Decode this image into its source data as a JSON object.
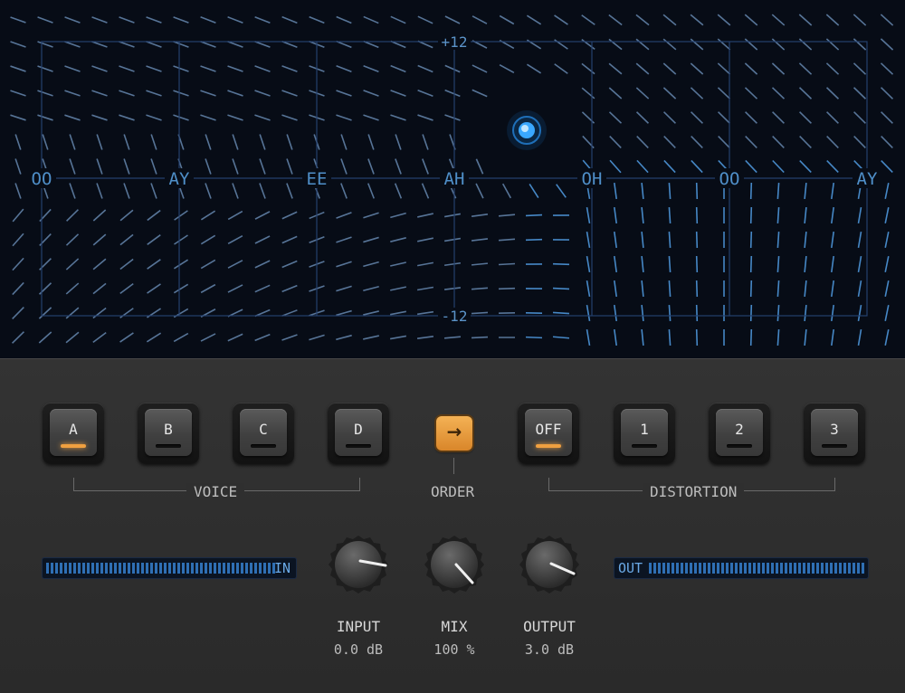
{
  "display": {
    "vowels": [
      "OO",
      "AY",
      "EE",
      "AH",
      "OH",
      "OO",
      "AY"
    ],
    "top_db": "+12",
    "bottom_db": "-12",
    "accent_color": "#3aa8ff"
  },
  "voice": {
    "label": "VOICE",
    "buttons": [
      {
        "label": "A",
        "active": true
      },
      {
        "label": "B",
        "active": false
      },
      {
        "label": "C",
        "active": false
      },
      {
        "label": "D",
        "active": false
      }
    ]
  },
  "order": {
    "label": "ORDER",
    "icon": "arrow-right-icon"
  },
  "distortion": {
    "label": "DISTORTION",
    "buttons": [
      {
        "label": "OFF",
        "active": true
      },
      {
        "label": "1",
        "active": false
      },
      {
        "label": "2",
        "active": false
      },
      {
        "label": "3",
        "active": false
      }
    ]
  },
  "meters": {
    "in_label": "IN",
    "out_label": "OUT"
  },
  "knobs": {
    "input": {
      "label": "INPUT",
      "value": "0.0 dB"
    },
    "mix": {
      "label": "MIX",
      "value": "100 %"
    },
    "output": {
      "label": "OUTPUT",
      "value": "3.0 dB"
    }
  },
  "colors": {
    "led_on": "#f0a040",
    "order_button": "#e89a3c",
    "meter_blue": "#2f6fb4"
  }
}
